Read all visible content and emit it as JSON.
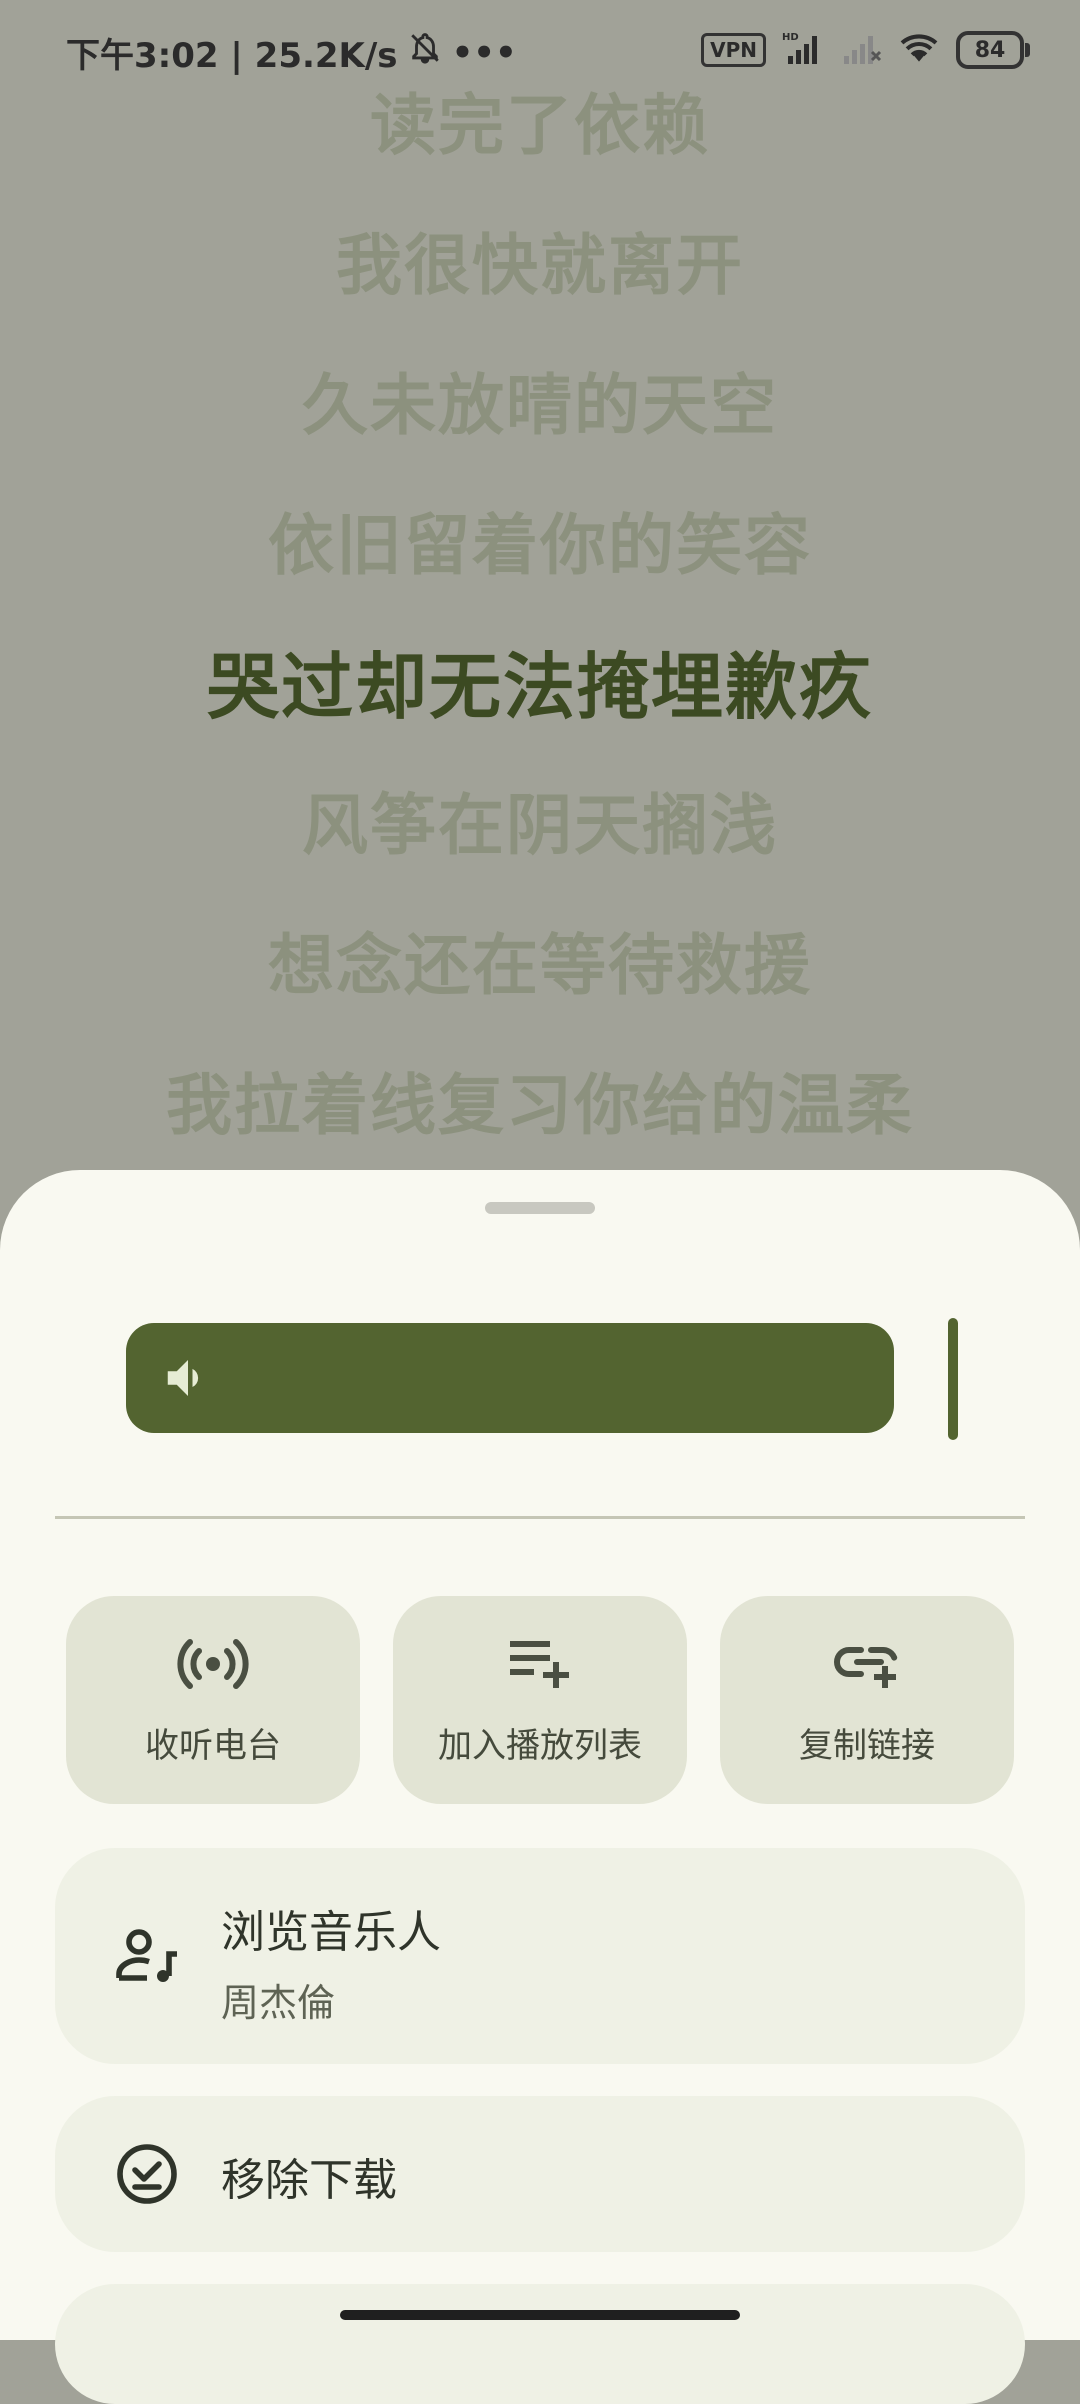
{
  "status_bar": {
    "time_speed": "下午3:02 | 25.2K/s",
    "more": "•••",
    "vpn": "VPN",
    "hd": "HD",
    "battery": "84"
  },
  "lyrics": [
    {
      "text": "读完了依赖",
      "active": false
    },
    {
      "text": "我很快就离开",
      "active": false
    },
    {
      "text": "久未放晴的天空",
      "active": false
    },
    {
      "text": "依旧留着你的笑容",
      "active": false
    },
    {
      "text": "哭过却无法掩埋歉疚",
      "active": true
    },
    {
      "text": "风筝在阴天搁浅",
      "active": false
    },
    {
      "text": "想念还在等待救援",
      "active": false
    },
    {
      "text": "我拉着线复习你给的温柔",
      "active": false
    }
  ],
  "volume": {
    "level": 0.93
  },
  "actions": [
    {
      "label": "收听电台",
      "icon": "radio-icon"
    },
    {
      "label": "加入播放列表",
      "icon": "playlist-add-icon"
    },
    {
      "label": "复制链接",
      "icon": "link-add-icon"
    }
  ],
  "artist_row": {
    "title": "浏览音乐人",
    "subtitle": "周杰倫",
    "icon": "artist-icon"
  },
  "download_row": {
    "title": "移除下载",
    "icon": "download-done-icon"
  },
  "colors": {
    "accent": "#536430",
    "sheet_bg": "#f9f9f1",
    "tile_bg": "#e2e4d4",
    "lyric_active": "#3c4a22",
    "lyric_inactive": "#8c917e",
    "scrim": "#a1a298"
  }
}
